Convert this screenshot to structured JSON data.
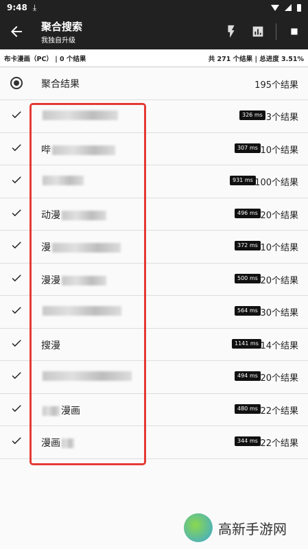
{
  "status_bar": {
    "time": "9:48",
    "download_glyph": "⤓"
  },
  "app_bar": {
    "title": "聚合搜索",
    "subtitle": "我独自升级"
  },
  "summary": {
    "left": "布卡漫画（PC） | 0 个结果",
    "right": "共 271 个结果 | 总进度 3.51%"
  },
  "aggregate": {
    "label": "聚合结果",
    "count": "195个结果"
  },
  "sources": [
    {
      "name_visible": "",
      "ms": "326 ms",
      "results": "3个结果"
    },
    {
      "name_visible": "哔",
      "ms": "307 ms",
      "results": "10个结果"
    },
    {
      "name_visible": "",
      "ms": "931 ms",
      "results": "100个结果"
    },
    {
      "name_visible": "动漫",
      "ms": "496 ms",
      "results": "20个结果"
    },
    {
      "name_visible": "漫",
      "ms": "372 ms",
      "results": "10个结果"
    },
    {
      "name_visible": "漫漫",
      "ms": "500 ms",
      "results": "20个结果"
    },
    {
      "name_visible": "",
      "ms": "564 ms",
      "results": "30个结果"
    },
    {
      "name_visible": "搜漫",
      "ms": "1141 ms",
      "results": "14个结果"
    },
    {
      "name_visible": "",
      "ms": "494 ms",
      "results": "20个结果"
    },
    {
      "name_visible": "漫画",
      "ms": "480 ms",
      "results": "22个结果"
    },
    {
      "name_visible": "漫画",
      "ms": "344 ms",
      "results": "22个结果"
    }
  ],
  "watermark": {
    "text": "高新手游网"
  },
  "colors": {
    "app_bar": "#212121",
    "highlight": "#e53935"
  }
}
